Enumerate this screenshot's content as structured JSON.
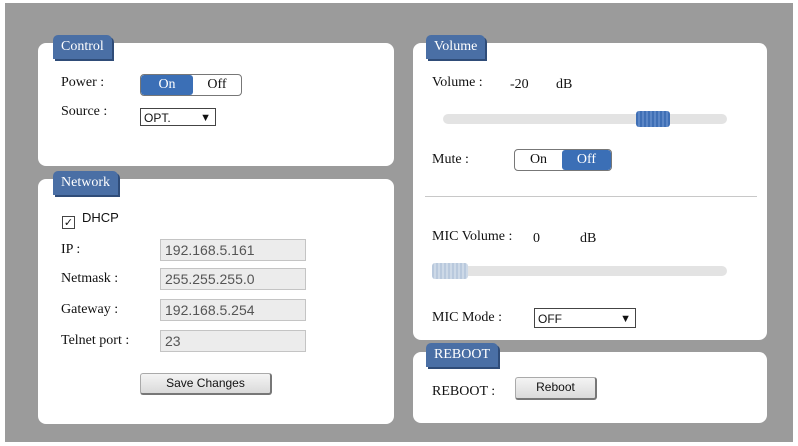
{
  "control": {
    "title": "Control",
    "power_label": "Power :",
    "power_on": "On",
    "power_off": "Off",
    "power_state": "On",
    "source_label": "Source :",
    "source_value": "OPT."
  },
  "network": {
    "title": "Network",
    "dhcp_label": "DHCP",
    "dhcp_checked": true,
    "ip_label": "IP :",
    "ip_value": "192.168.5.161",
    "netmask_label": "Netmask :",
    "netmask_value": "255.255.255.0",
    "gateway_label": "Gateway :",
    "gateway_value": "192.168.5.254",
    "telnet_label": "Telnet port :",
    "telnet_value": "23",
    "save_label": "Save Changes"
  },
  "volume": {
    "title": "Volume",
    "volume_label": "Volume :",
    "volume_value": "-20",
    "volume_unit": "dB",
    "volume_level": 0.77,
    "mute_label": "Mute :",
    "mute_on": "On",
    "mute_off": "Off",
    "mute_state": "Off",
    "mic_volume_label": "MIC Volume :",
    "mic_volume_value": "0",
    "mic_volume_unit": "dB",
    "mic_level": 0.0,
    "mic_mode_label": "MIC Mode :",
    "mic_mode_value": "OFF"
  },
  "reboot": {
    "title": "REBOOT",
    "label": "REBOOT :",
    "button_label": "Reboot"
  },
  "colors": {
    "tab": "#4a6fa5",
    "toggle_active": "#3b6fb6",
    "frame": "#9b9b9b"
  }
}
